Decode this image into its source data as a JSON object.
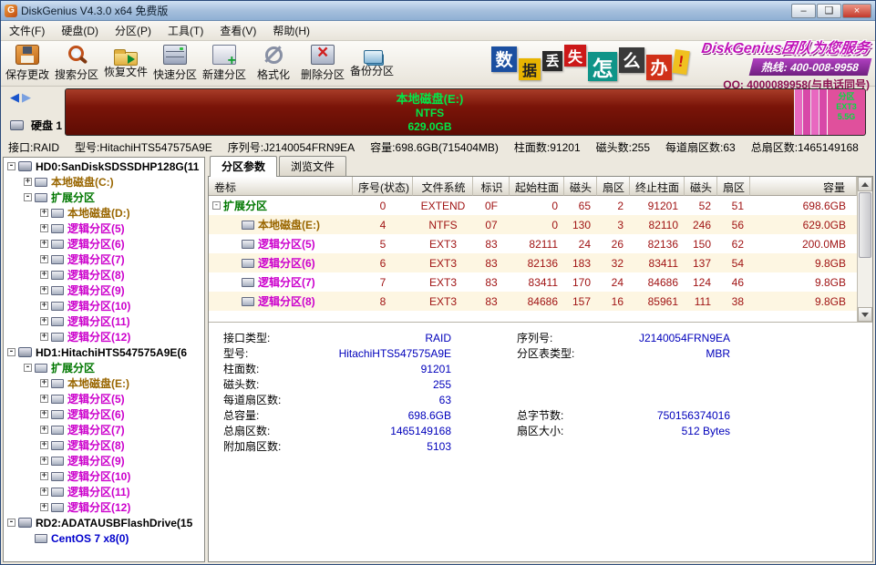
{
  "window": {
    "title": "DiskGenius V4.3.0 x64 免费版"
  },
  "menubar": [
    {
      "label": "文件(F)",
      "name": "menu-file"
    },
    {
      "label": "硬盘(D)",
      "name": "menu-disk"
    },
    {
      "label": "分区(P)",
      "name": "menu-partition"
    },
    {
      "label": "工具(T)",
      "name": "menu-tools"
    },
    {
      "label": "查看(V)",
      "name": "menu-view"
    },
    {
      "label": "帮助(H)",
      "name": "menu-help"
    }
  ],
  "toolbar": [
    {
      "label": "保存更改",
      "icon": "save-icon",
      "name": "save-changes-button"
    },
    {
      "label": "搜索分区",
      "icon": "search-icon",
      "name": "search-partition-button"
    },
    {
      "label": "恢复文件",
      "icon": "recover-icon",
      "name": "recover-files-button"
    },
    {
      "label": "快速分区",
      "icon": "quick-partition-icon",
      "name": "quick-partition-button"
    },
    {
      "label": "新建分区",
      "icon": "new-partition-icon",
      "name": "new-partition-button"
    },
    {
      "label": "格式化",
      "icon": "format-icon",
      "name": "format-button"
    },
    {
      "label": "删除分区",
      "icon": "delete-icon",
      "name": "delete-partition-button"
    },
    {
      "label": "备份分区",
      "icon": "backup-icon",
      "name": "backup-partition-button"
    }
  ],
  "ad": {
    "tiles": [
      {
        "ch": "数",
        "bg": "#1b4fa0",
        "fg": "#ffffff"
      },
      {
        "ch": "据",
        "bg": "#e8b400",
        "fg": "#222222"
      },
      {
        "ch": "丢",
        "bg": "#2a2a2a",
        "fg": "#ffffff"
      },
      {
        "ch": "失",
        "bg": "#cc1818",
        "fg": "#ffffff"
      },
      {
        "ch": "怎",
        "bg": "#0f9488",
        "fg": "#ffffff"
      },
      {
        "ch": "么",
        "bg": "#3a3a3a",
        "fg": "#ffffff"
      },
      {
        "ch": "办",
        "bg": "#d03018",
        "fg": "#ffffff"
      },
      {
        "ch": "!",
        "bg": "#f0c020",
        "fg": "#cc1010"
      }
    ],
    "slogan": "DiskGenius团队为您服务",
    "hotline": "热线: 400-008-9958",
    "qq": "QQ: 4000089958(与电话同号)"
  },
  "disk_nav": {
    "label": "硬盘 1"
  },
  "disk_graph": {
    "name": "本地磁盘(E:)",
    "fs": "NTFS",
    "size": "629.0GB",
    "tail": [
      "分区",
      "EXT3",
      "5.5G"
    ]
  },
  "disk_info": [
    {
      "label": "接口:",
      "value": "RAID"
    },
    {
      "label": "型号:",
      "value": "HitachiHTS547575A9E"
    },
    {
      "label": "序列号:",
      "value": "J2140054FRN9EA"
    },
    {
      "label": "容量:",
      "value": "698.6GB(715404MB)"
    },
    {
      "label": "柱面数:",
      "value": "91201"
    },
    {
      "label": "磁头数:",
      "value": "255"
    },
    {
      "label": "每道扇区数:",
      "value": "63"
    },
    {
      "label": "总扇区数:",
      "value": "1465149168"
    }
  ],
  "tree": [
    {
      "level": 0,
      "exp": "-",
      "icon": "hd-icon",
      "color": "c-black",
      "label": "HD0:SanDiskSDSSDHP128G(11"
    },
    {
      "level": 1,
      "exp": "+",
      "icon": "disk-icon",
      "color": "c-brown",
      "label": "本地磁盘(C:)"
    },
    {
      "level": 1,
      "exp": "-",
      "icon": "disk-icon",
      "color": "c-green",
      "label": "扩展分区"
    },
    {
      "level": 2,
      "exp": "+",
      "icon": "disk-icon",
      "color": "c-brown",
      "label": "本地磁盘(D:)"
    },
    {
      "level": 2,
      "exp": "+",
      "icon": "disk-icon",
      "color": "c-magenta",
      "label": "逻辑分区(5)"
    },
    {
      "level": 2,
      "exp": "+",
      "icon": "disk-icon",
      "color": "c-magenta",
      "label": "逻辑分区(6)"
    },
    {
      "level": 2,
      "exp": "+",
      "icon": "disk-icon",
      "color": "c-magenta",
      "label": "逻辑分区(7)"
    },
    {
      "level": 2,
      "exp": "+",
      "icon": "disk-icon",
      "color": "c-magenta",
      "label": "逻辑分区(8)"
    },
    {
      "level": 2,
      "exp": "+",
      "icon": "disk-icon",
      "color": "c-magenta",
      "label": "逻辑分区(9)"
    },
    {
      "level": 2,
      "exp": "+",
      "icon": "disk-icon",
      "color": "c-magenta",
      "label": "逻辑分区(10)"
    },
    {
      "level": 2,
      "exp": "+",
      "icon": "disk-icon",
      "color": "c-magenta",
      "label": "逻辑分区(11)"
    },
    {
      "level": 2,
      "exp": "+",
      "icon": "disk-icon",
      "color": "c-magenta",
      "label": "逻辑分区(12)"
    },
    {
      "level": 0,
      "exp": "-",
      "icon": "hd-icon",
      "color": "c-black",
      "label": "HD1:HitachiHTS547575A9E(6"
    },
    {
      "level": 1,
      "exp": "-",
      "icon": "disk-icon",
      "color": "c-green",
      "label": "扩展分区"
    },
    {
      "level": 2,
      "exp": "+",
      "icon": "disk-icon",
      "color": "c-brown",
      "label": "本地磁盘(E:)"
    },
    {
      "level": 2,
      "exp": "+",
      "icon": "disk-icon",
      "color": "c-magenta",
      "label": "逻辑分区(5)"
    },
    {
      "level": 2,
      "exp": "+",
      "icon": "disk-icon",
      "color": "c-magenta",
      "label": "逻辑分区(6)"
    },
    {
      "level": 2,
      "exp": "+",
      "icon": "disk-icon",
      "color": "c-magenta",
      "label": "逻辑分区(7)"
    },
    {
      "level": 2,
      "exp": "+",
      "icon": "disk-icon",
      "color": "c-magenta",
      "label": "逻辑分区(8)"
    },
    {
      "level": 2,
      "exp": "+",
      "icon": "disk-icon",
      "color": "c-magenta",
      "label": "逻辑分区(9)"
    },
    {
      "level": 2,
      "exp": "+",
      "icon": "disk-icon",
      "color": "c-magenta",
      "label": "逻辑分区(10)"
    },
    {
      "level": 2,
      "exp": "+",
      "icon": "disk-icon",
      "color": "c-magenta",
      "label": "逻辑分区(11)"
    },
    {
      "level": 2,
      "exp": "+",
      "icon": "disk-icon",
      "color": "c-magenta",
      "label": "逻辑分区(12)"
    },
    {
      "level": 0,
      "exp": "-",
      "icon": "hd-icon",
      "color": "c-black",
      "label": "RD2:ADATAUSBFlashDrive(15"
    },
    {
      "level": 1,
      "exp": "",
      "icon": "disk-icon",
      "color": "c-blue",
      "label": "CentOS 7 x8(0)"
    }
  ],
  "tabs": [
    {
      "label": "分区参数",
      "cls": "active",
      "name": "tab-partition-params"
    },
    {
      "label": "浏览文件",
      "cls": "",
      "name": "tab-browse-files"
    }
  ],
  "table": {
    "columns": [
      "卷标",
      "序号(状态)",
      "文件系统",
      "标识",
      "起始柱面",
      "磁头",
      "扇区",
      "终止柱面",
      "磁头",
      "扇区",
      "容量"
    ],
    "rows": [
      {
        "exp": "-",
        "indent": 0,
        "icon": "",
        "color": "c-green",
        "label": "扩展分区",
        "cells": [
          "0",
          "EXTEND",
          "0F",
          "0",
          "65",
          "2",
          "91201",
          "52",
          "51",
          "698.6GB"
        ]
      },
      {
        "exp": "",
        "indent": 1,
        "icon": "disk-icon",
        "color": "c-brown",
        "label": "本地磁盘(E:)",
        "cells": [
          "4",
          "NTFS",
          "07",
          "0",
          "130",
          "3",
          "82110",
          "246",
          "56",
          "629.0GB"
        ]
      },
      {
        "exp": "",
        "indent": 1,
        "icon": "disk-icon",
        "color": "c-magenta",
        "label": "逻辑分区(5)",
        "cells": [
          "5",
          "EXT3",
          "83",
          "82111",
          "24",
          "26",
          "82136",
          "150",
          "62",
          "200.0MB"
        ]
      },
      {
        "exp": "",
        "indent": 1,
        "icon": "disk-icon",
        "color": "c-magenta",
        "label": "逻辑分区(6)",
        "cells": [
          "6",
          "EXT3",
          "83",
          "82136",
          "183",
          "32",
          "83411",
          "137",
          "54",
          "9.8GB"
        ]
      },
      {
        "exp": "",
        "indent": 1,
        "icon": "disk-icon",
        "color": "c-magenta",
        "label": "逻辑分区(7)",
        "cells": [
          "7",
          "EXT3",
          "83",
          "83411",
          "170",
          "24",
          "84686",
          "124",
          "46",
          "9.8GB"
        ]
      },
      {
        "exp": "",
        "indent": 1,
        "icon": "disk-icon",
        "color": "c-magenta",
        "label": "逻辑分区(8)",
        "cells": [
          "8",
          "EXT3",
          "83",
          "84686",
          "157",
          "16",
          "85961",
          "111",
          "38",
          "9.8GB"
        ]
      }
    ]
  },
  "details": {
    "rows": [
      {
        "l1": "接口类型:",
        "v1": "RAID",
        "l2": "序列号:",
        "v2": "J2140054FRN9EA"
      },
      {
        "l1": "型号:",
        "v1": "HitachiHTS547575A9E",
        "l2": "分区表类型:",
        "v2": "MBR"
      },
      {
        "l1": "柱面数:",
        "v1": "91201",
        "l2": "",
        "v2": ""
      },
      {
        "l1": "磁头数:",
        "v1": "255",
        "l2": "",
        "v2": ""
      },
      {
        "l1": "每道扇区数:",
        "v1": "63",
        "l2": "",
        "v2": ""
      },
      {
        "l1": "总容量:",
        "v1": "698.6GB",
        "l2": "总字节数:",
        "v2": "750156374016"
      },
      {
        "l1": "总扇区数:",
        "v1": "1465149168",
        "l2": "扇区大小:",
        "v2": "512 Bytes"
      },
      {
        "l1": "附加扇区数:",
        "v1": "5103",
        "l2": "",
        "v2": ""
      }
    ]
  }
}
